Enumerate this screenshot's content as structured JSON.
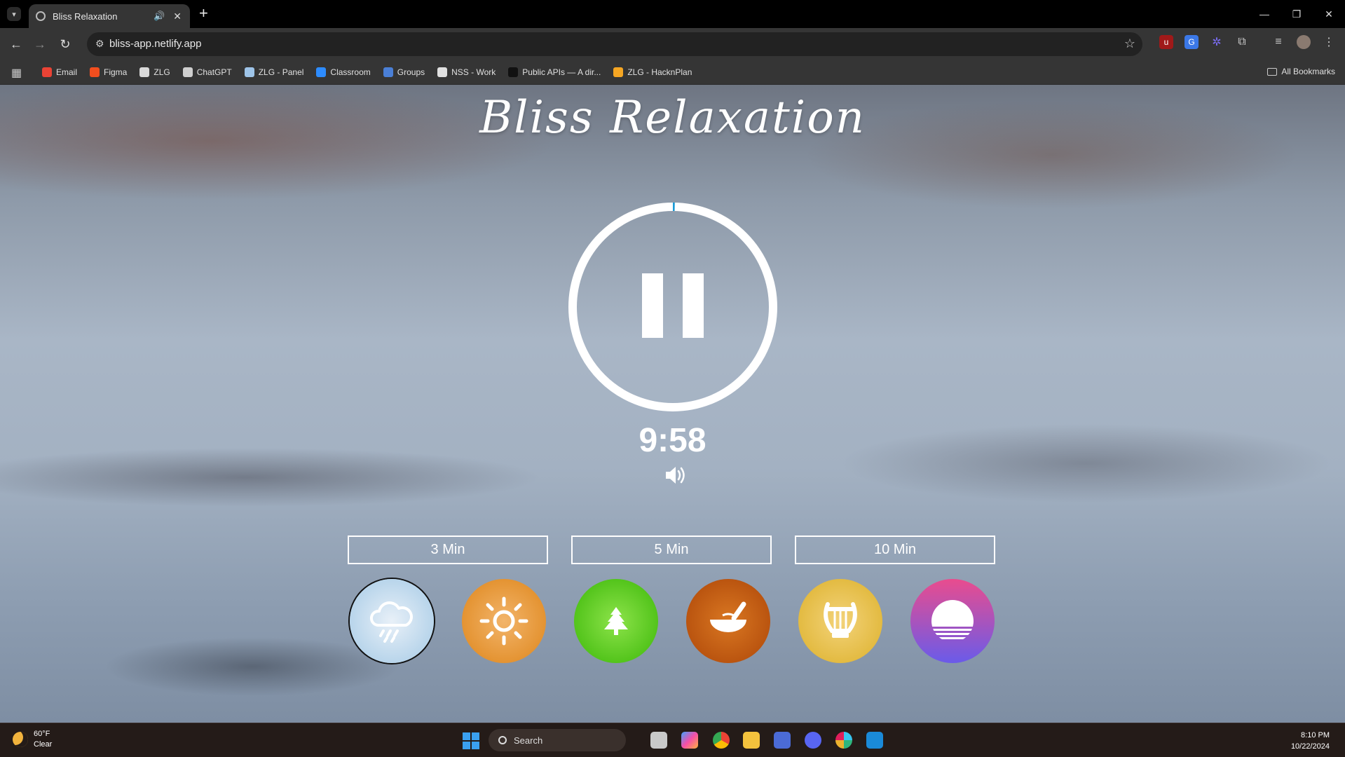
{
  "browser": {
    "tab_title": "Bliss Relaxation",
    "tab_audio_icon": "🔊",
    "tab_close": "✕",
    "new_tab": "+",
    "url": "bliss-app.netlify.app",
    "bookmarks": [
      {
        "label": "Email",
        "color": "#ea4335"
      },
      {
        "label": "Figma",
        "color": "#f24e1e"
      },
      {
        "label": "ZLG",
        "color": "#d9d9d9"
      },
      {
        "label": "ChatGPT",
        "color": "#cfcfcf"
      },
      {
        "label": "ZLG - Panel",
        "color": "#9ec4e8"
      },
      {
        "label": "Classroom",
        "color": "#2d8cff"
      },
      {
        "label": "Groups",
        "color": "#4a7fd6"
      },
      {
        "label": "NSS - Work",
        "color": "#e0e0e0"
      },
      {
        "label": "Public APIs — A dir...",
        "color": "#111111"
      },
      {
        "label": "ZLG - HacknPlan",
        "color": "#f5a623"
      }
    ],
    "all_bookmarks": "All Bookmarks"
  },
  "app": {
    "title": "Bliss Relaxation",
    "timer": "9:58",
    "progress": 0.003,
    "durations": [
      "3 Min",
      "5 Min",
      "10 Min"
    ],
    "sounds": [
      {
        "name": "rain",
        "icon": "rain-cloud-icon",
        "colors": [
          "#b5d3ea",
          "#e8f0f8"
        ],
        "selected": true
      },
      {
        "name": "sun",
        "icon": "sun-icon",
        "colors": [
          "#e3912e",
          "#f2b46a"
        ],
        "selected": false
      },
      {
        "name": "forest",
        "icon": "tree-icon",
        "colors": [
          "#4fc218",
          "#8de34a"
        ],
        "selected": false
      },
      {
        "name": "bowl",
        "icon": "singing-bowl-icon",
        "colors": [
          "#b8520e",
          "#d97722"
        ],
        "selected": false
      },
      {
        "name": "harp",
        "icon": "lyre-icon",
        "colors": [
          "#e2b93e",
          "#f3d37a"
        ],
        "selected": false
      },
      {
        "name": "sunset",
        "icon": "sunset-icon",
        "colors": [
          "#e94c8e",
          "#6a5be9"
        ],
        "selected": false
      }
    ]
  },
  "taskbar": {
    "temperature": "60°F",
    "condition": "Clear",
    "search_placeholder": "Search",
    "time": "8:10 PM",
    "date": "10/22/2024"
  }
}
